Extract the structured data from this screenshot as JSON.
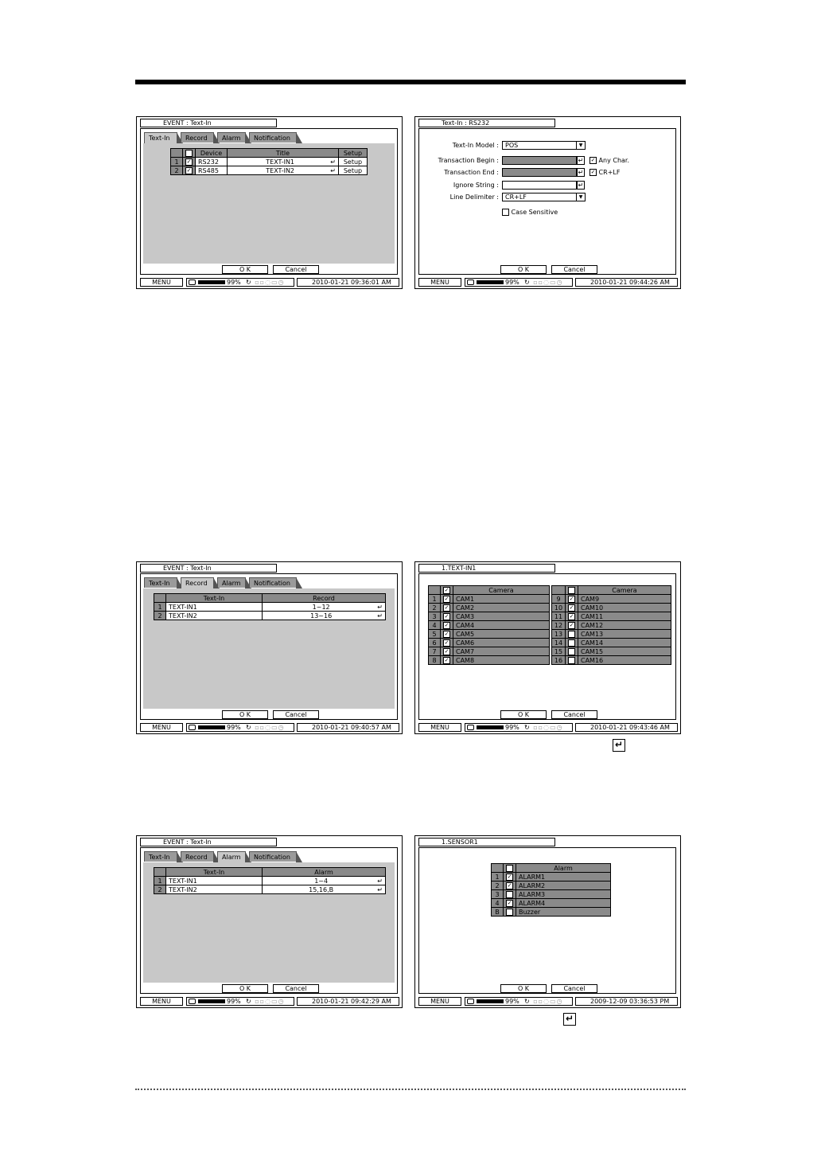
{
  "screen1": {
    "title": "EVENT : Text-In",
    "tabs": [
      "Text-In",
      "Record",
      "Alarm",
      "Notification"
    ],
    "headers": [
      "",
      "",
      "Device",
      "Title",
      "Setup"
    ],
    "rows": [
      {
        "num": "1",
        "device": "RS232",
        "title": "TEXT-IN1",
        "setup": "Setup"
      },
      {
        "num": "2",
        "device": "RS485",
        "title": "TEXT-IN2",
        "setup": "Setup"
      }
    ],
    "ok": "O K",
    "cancel": "Cancel",
    "status": {
      "menu": "MENU",
      "pct": "99%",
      "time": "2010-01-21 09:36:01 AM"
    }
  },
  "screen2": {
    "title": "Text-In : RS232",
    "model_label": "Text-In Model :",
    "model_value": "POS",
    "begin_label": "Transaction Begin :",
    "any_char": "Any Char.",
    "end_label": "Transaction End :",
    "crlf_check": "CR+LF",
    "ignore_label": "Ignore String :",
    "delim_label": "Line Delimiter :",
    "delim_value": "CR+LF",
    "case_sensitive": "Case Sensitive",
    "ok": "O K",
    "cancel": "Cancel",
    "status": {
      "menu": "MENU",
      "pct": "99%",
      "time": "2010-01-21 09:44:26 AM"
    }
  },
  "screen3": {
    "title": "EVENT : Text-In",
    "tabs": [
      "Text-In",
      "Record",
      "Alarm",
      "Notification"
    ],
    "headers": [
      "Text-In",
      "Record"
    ],
    "rows": [
      {
        "num": "1",
        "name": "TEXT-IN1",
        "value": "1~12"
      },
      {
        "num": "2",
        "name": "TEXT-IN2",
        "value": "13~16"
      }
    ],
    "ok": "O K",
    "cancel": "Cancel",
    "status": {
      "menu": "MENU",
      "pct": "99%",
      "time": "2010-01-21 09:40:57 AM"
    }
  },
  "screen4": {
    "title": "1.TEXT-IN1",
    "header": "Camera",
    "left": [
      {
        "num": "1",
        "name": "CAM1",
        "checked": true
      },
      {
        "num": "2",
        "name": "CAM2",
        "checked": true
      },
      {
        "num": "3",
        "name": "CAM3",
        "checked": true
      },
      {
        "num": "4",
        "name": "CAM4",
        "checked": true
      },
      {
        "num": "5",
        "name": "CAM5",
        "checked": true
      },
      {
        "num": "6",
        "name": "CAM6",
        "checked": true
      },
      {
        "num": "7",
        "name": "CAM7",
        "checked": true
      },
      {
        "num": "8",
        "name": "CAM8",
        "checked": true
      }
    ],
    "right": [
      {
        "num": "9",
        "name": "CAM9",
        "checked": true
      },
      {
        "num": "10",
        "name": "CAM10",
        "checked": true
      },
      {
        "num": "11",
        "name": "CAM11",
        "checked": true
      },
      {
        "num": "12",
        "name": "CAM12",
        "checked": true
      },
      {
        "num": "13",
        "name": "CAM13",
        "checked": false
      },
      {
        "num": "14",
        "name": "CAM14",
        "checked": false
      },
      {
        "num": "15",
        "name": "CAM15",
        "checked": false
      },
      {
        "num": "16",
        "name": "CAM16",
        "checked": false
      }
    ],
    "ok": "O K",
    "cancel": "Cancel",
    "status": {
      "menu": "MENU",
      "pct": "99%",
      "time": "2010-01-21 09:43:46 AM"
    }
  },
  "screen5": {
    "title": "EVENT : Text-In",
    "tabs": [
      "Text-In",
      "Record",
      "Alarm",
      "Notification"
    ],
    "headers": [
      "Text-In",
      "Alarm"
    ],
    "rows": [
      {
        "num": "1",
        "name": "TEXT-IN1",
        "value": "1~4"
      },
      {
        "num": "2",
        "name": "TEXT-IN2",
        "value": "15,16,B"
      }
    ],
    "ok": "O K",
    "cancel": "Cancel",
    "status": {
      "menu": "MENU",
      "pct": "99%",
      "time": "2010-01-21 09:42:29 AM"
    }
  },
  "screen6": {
    "title": "1.SENSOR1",
    "header": "Alarm",
    "rows": [
      {
        "num": "1",
        "name": "ALARM1",
        "checked": true
      },
      {
        "num": "2",
        "name": "ALARM2",
        "checked": true
      },
      {
        "num": "3",
        "name": "ALARM3",
        "checked": false
      },
      {
        "num": "4",
        "name": "ALARM4",
        "checked": true
      },
      {
        "num": "B",
        "name": "Buzzer",
        "checked": false
      }
    ],
    "ok": "O K",
    "cancel": "Cancel",
    "status": {
      "menu": "MENU",
      "pct": "99%",
      "time": "2009-12-09 03:36:53 PM"
    }
  },
  "icons": {
    "enter": "enter-icon",
    "check": "checkmark-icon",
    "dropdown": "dropdown-arrow-icon",
    "hdd": "hdd-icon"
  }
}
